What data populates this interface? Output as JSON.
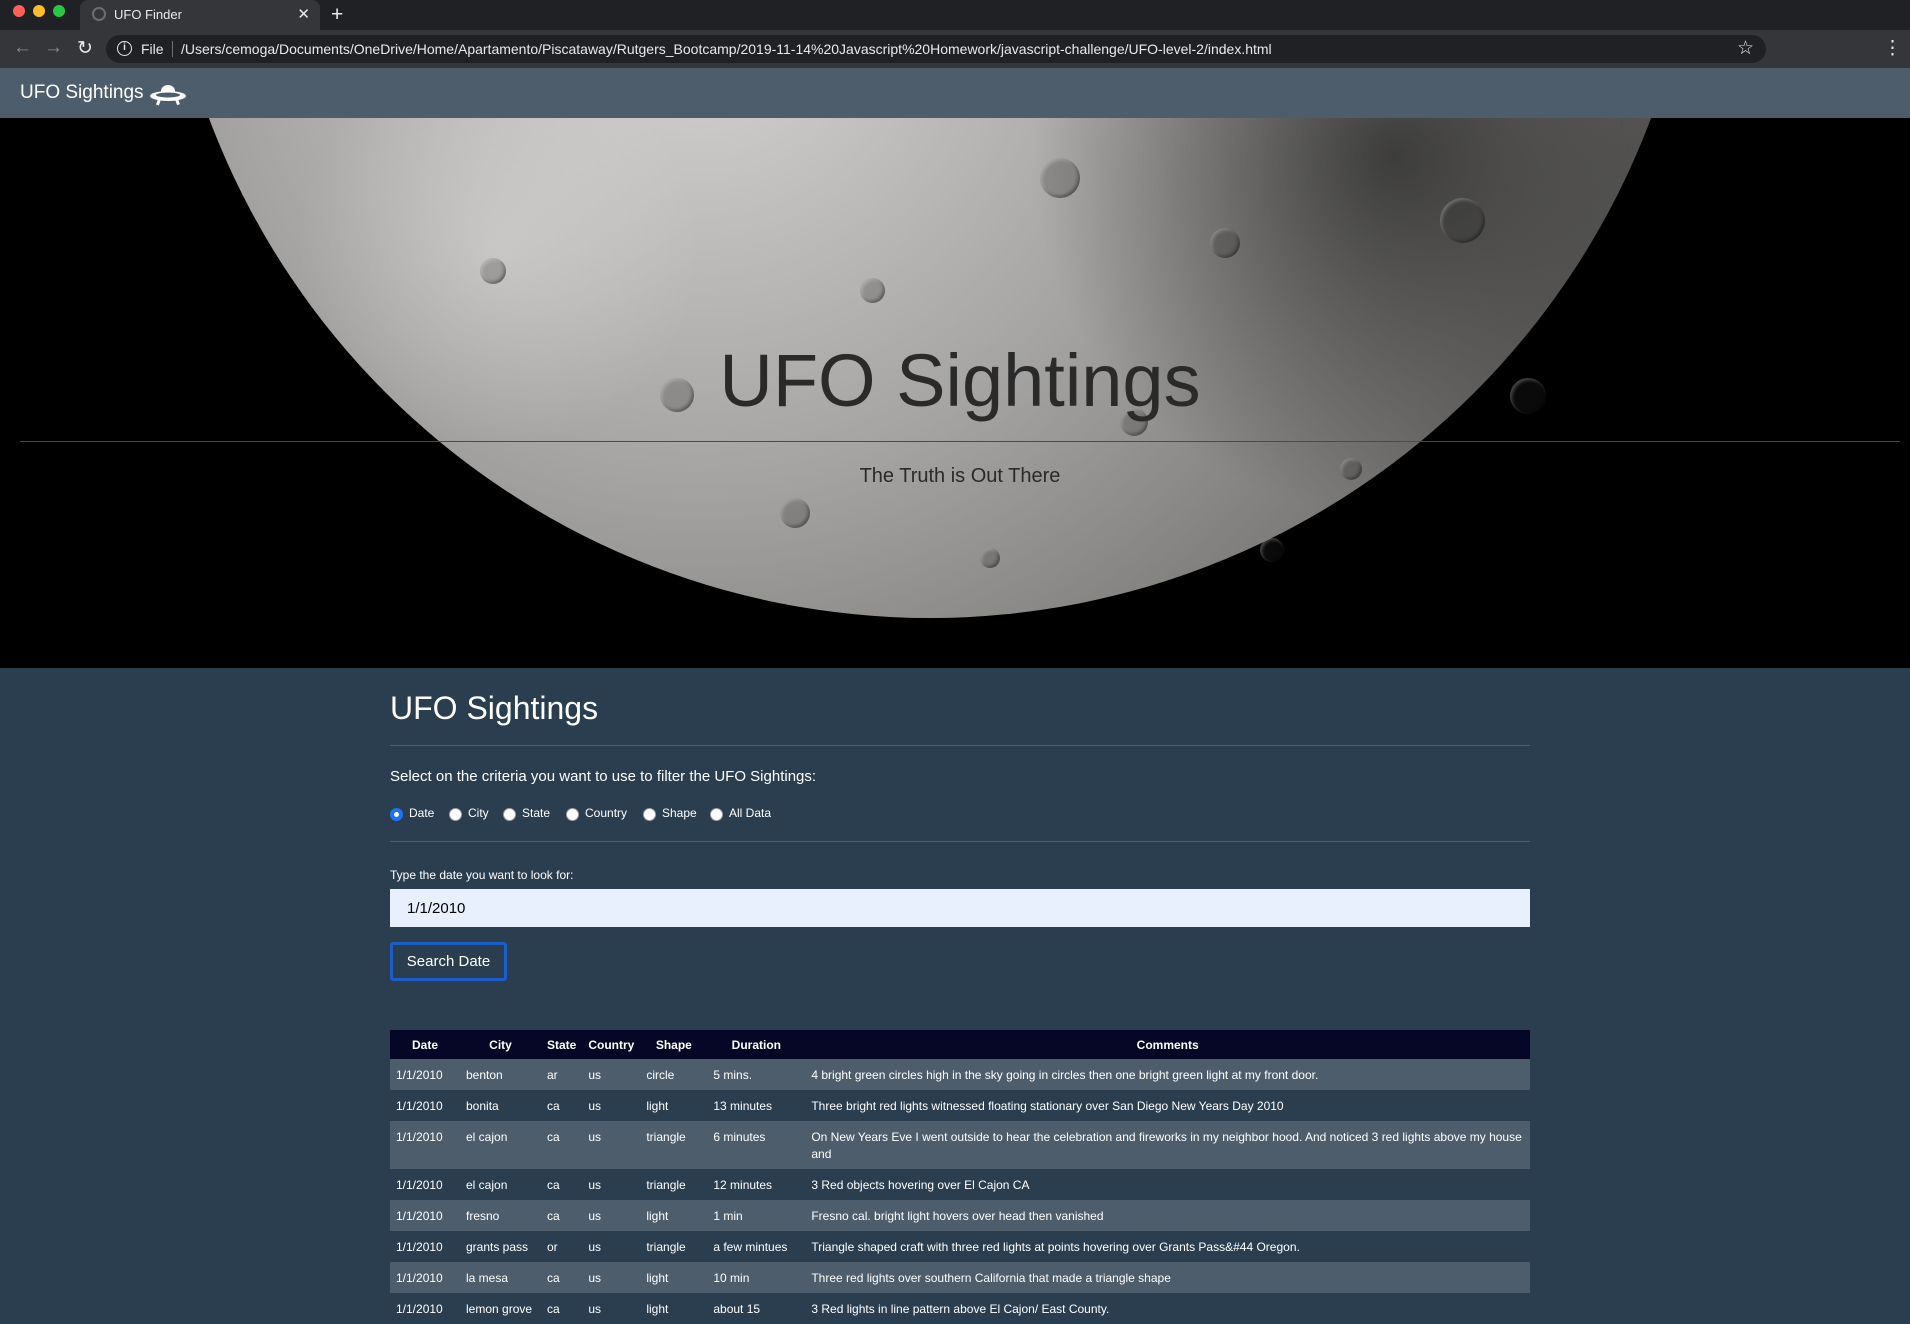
{
  "browser": {
    "tab_title": "UFO Finder",
    "scheme_label": "File",
    "url": "/Users/cemoga/Documents/OneDrive/Home/Apartamento/Piscataway/Rutgers_Bootcamp/2019-11-14%20Javascript%20Homework/javascript-challenge/UFO-level-2/index.html",
    "icons": [
      "back-arrow-icon",
      "forward-arrow-icon",
      "reload-icon",
      "info-icon",
      "star-icon",
      "menu-icon"
    ]
  },
  "navbar": {
    "brand": "UFO Sightings",
    "icon": "ufo-icon"
  },
  "hero": {
    "title": "UFO Sightings",
    "subtitle": "The Truth is Out There"
  },
  "main": {
    "title": "UFO Sightings",
    "instruction": "Select on the criteria you want to use to filter the UFO Sightings:",
    "filters": [
      {
        "label": "Date",
        "checked": true
      },
      {
        "label": "City",
        "checked": false
      },
      {
        "label": "State",
        "checked": false
      },
      {
        "label": "Country",
        "checked": false
      },
      {
        "label": "Shape",
        "checked": false
      },
      {
        "label": "All Data",
        "checked": false
      }
    ],
    "field_label": "Type the date you want to look for:",
    "date_value": "1/1/2010",
    "search_button": "Search Date"
  },
  "table": {
    "headers": [
      "Date",
      "City",
      "State",
      "Country",
      "Shape",
      "Duration",
      "Comments"
    ],
    "rows": [
      [
        "1/1/2010",
        "benton",
        "ar",
        "us",
        "circle",
        "5 mins.",
        "4 bright green circles high in the sky going in circles then one bright green light at my front door."
      ],
      [
        "1/1/2010",
        "bonita",
        "ca",
        "us",
        "light",
        "13 minutes",
        "Three bright red lights witnessed floating stationary over San Diego New Years Day 2010"
      ],
      [
        "1/1/2010",
        "el cajon",
        "ca",
        "us",
        "triangle",
        "6 minutes",
        "On New Years Eve I went outside to hear the celebration and fireworks in my neighbor hood. And noticed 3 red lights above my house and"
      ],
      [
        "1/1/2010",
        "el cajon",
        "ca",
        "us",
        "triangle",
        "12 minutes",
        "3 Red objects hovering over El Cajon CA"
      ],
      [
        "1/1/2010",
        "fresno",
        "ca",
        "us",
        "light",
        "1 min",
        "Fresno cal. bright light hovers over head then vanished"
      ],
      [
        "1/1/2010",
        "grants pass",
        "or",
        "us",
        "triangle",
        "a few mintues",
        "Triangle shaped craft with three red lights at points hovering over Grants Pass&#44 Oregon."
      ],
      [
        "1/1/2010",
        "la mesa",
        "ca",
        "us",
        "light",
        "10 min",
        "Three red lights over southern California that made a triangle shape"
      ],
      [
        "1/1/2010",
        "lemon grove",
        "ca",
        "us",
        "light",
        "about 15",
        "3 Red lights in line pattern above El Cajon/ East County."
      ]
    ]
  },
  "colors": {
    "navbar": "#4e5d6c",
    "page_bg": "#2b3e50",
    "table_header": "#060627",
    "accent": "#1e74f0"
  }
}
